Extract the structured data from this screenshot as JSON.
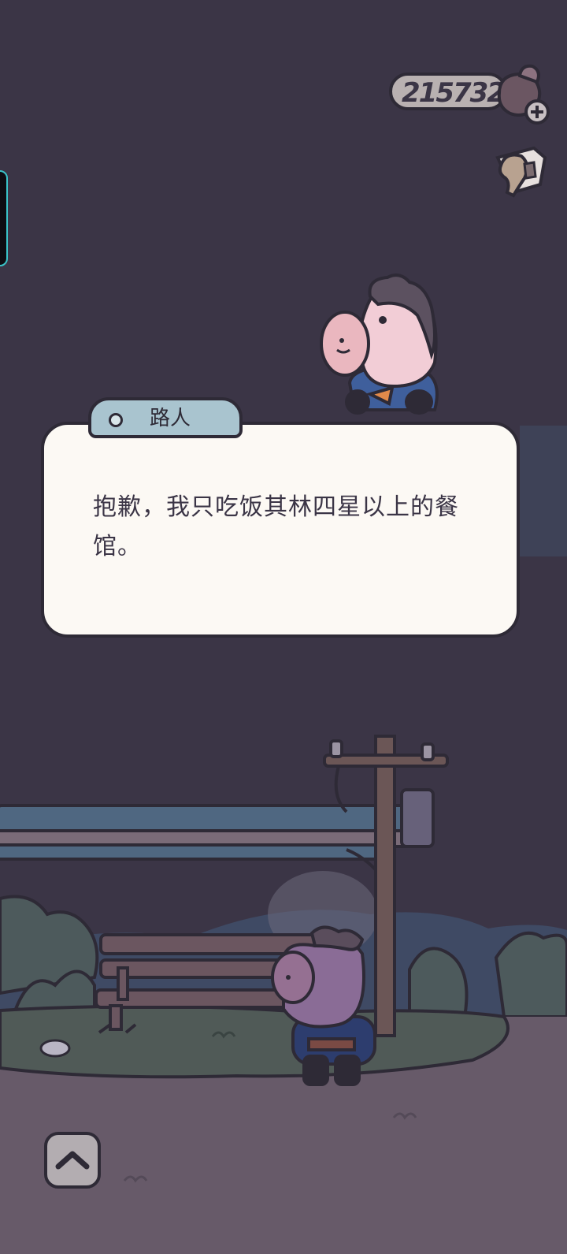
{
  "hud": {
    "coins": "215732",
    "coin_icon": "coin-bag-plus-icon",
    "hint_icon": "hint-pointer-icon"
  },
  "dialog": {
    "speaker": "路人",
    "text": "抱歉，我只吃饭其林四星以上的餐馆。"
  },
  "controls": {
    "expand_icon": "chevron-up-icon"
  },
  "colors": {
    "sky": "#3b3546",
    "ground": "#675a69",
    "dialog_bg": "#fcf9f4",
    "name_tab_bg": "#a9c4cf",
    "outline": "#2e2a36",
    "character_pink": "#f2cdd6",
    "character_shirt": "#3f5f9c"
  }
}
